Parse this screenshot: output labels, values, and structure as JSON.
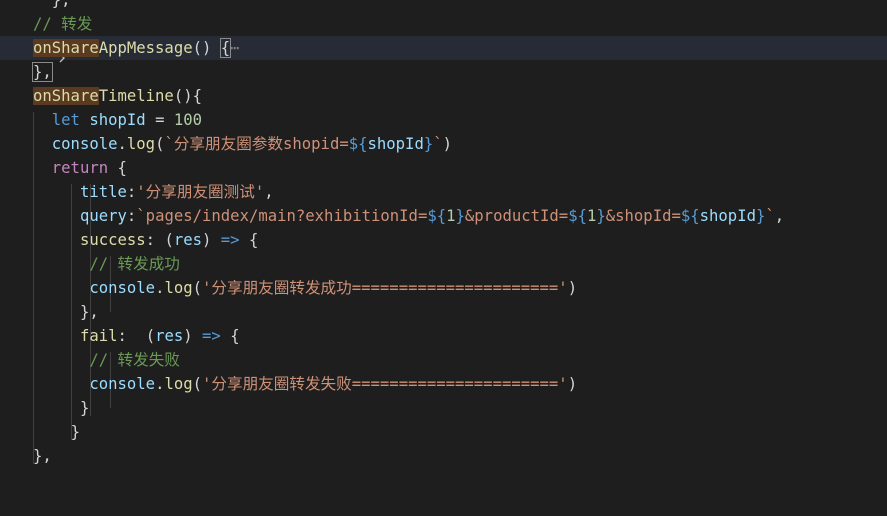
{
  "colors": {
    "background": "#1e1e1e",
    "keyword": "#569cd6",
    "control": "#c586c0",
    "function": "#dcdcaa",
    "variable": "#9cdcfe",
    "string": "#ce9178",
    "number": "#b5cea8",
    "comment": "#6a9955",
    "highlight": "#5a3a20",
    "lightbulb": "#f5c518"
  },
  "icons": {
    "lightbulb": "lightbulb-icon",
    "fold": "chevron-right-icon"
  },
  "lines": {
    "l0": {
      "text": "},",
      "partial": true
    },
    "l1": {
      "comment": "// 转发"
    },
    "l2": {
      "fn_hl": "onShare",
      "fn_rest": "AppMessage",
      "punct": "() ",
      "brace": "{",
      "dots": "⋯"
    },
    "l3": {
      "text": "},"
    },
    "l4": {
      "fn_hl": "onShare",
      "fn_rest": "Timeline",
      "punct": "(){"
    },
    "l5": {
      "kw": "let",
      "var": "shopId",
      "op": " = ",
      "num": "100"
    },
    "l6": {
      "obj": "console",
      "dot": ".",
      "fn": "log",
      "p1": "(",
      "s1": "`分享朋友圈参数shopid=",
      "tmpl_open": "${",
      "tmpl_var": "shopId",
      "tmpl_close": "}",
      "s2": "`",
      "p2": ")"
    },
    "l7": {
      "ctrl": "return",
      "brace": " {"
    },
    "l8": {
      "key": "title",
      "colon": ":",
      "str": "'分享朋友圈测试'",
      "comma": ","
    },
    "l9": {
      "key": "query",
      "colon": ":",
      "s1": "`pages/index/main?exhibitionId=",
      "t1o": "${",
      "t1v": "1",
      "t1c": "}",
      "s2": "&productId=",
      "t2o": "${",
      "t2v": "1",
      "t2c": "}",
      "s3": "&shopId=",
      "t3o": "${",
      "t3v": "shopId",
      "t3c": "}",
      "s4": "`",
      "comma": ","
    },
    "l10": {
      "key": "success",
      "colon": ": ",
      "p1": "(",
      "param": "res",
      "p2": ") ",
      "arrow": "=>",
      "brace": " {"
    },
    "l11": {
      "comment": "// 转发成功"
    },
    "l12": {
      "obj": "console",
      "dot": ".",
      "fn": "log",
      "p1": "(",
      "str": "'分享朋友圈转发成功======================'",
      "p2": ")"
    },
    "l13": {
      "text": "},"
    },
    "l14": {
      "key": "fail",
      "colon": ":  ",
      "p1": "(",
      "param": "res",
      "p2": ") ",
      "arrow": "=>",
      "brace": " {"
    },
    "l15": {
      "comment": "// 转发失败"
    },
    "l16": {
      "obj": "console",
      "dot": ".",
      "fn": "log",
      "p1": "(",
      "str": "'分享朋友圈转发失败======================'",
      "p2": ")"
    },
    "l17": {
      "text": "}"
    },
    "l18": {
      "text": "}"
    },
    "l19": {
      "text": "},"
    }
  }
}
